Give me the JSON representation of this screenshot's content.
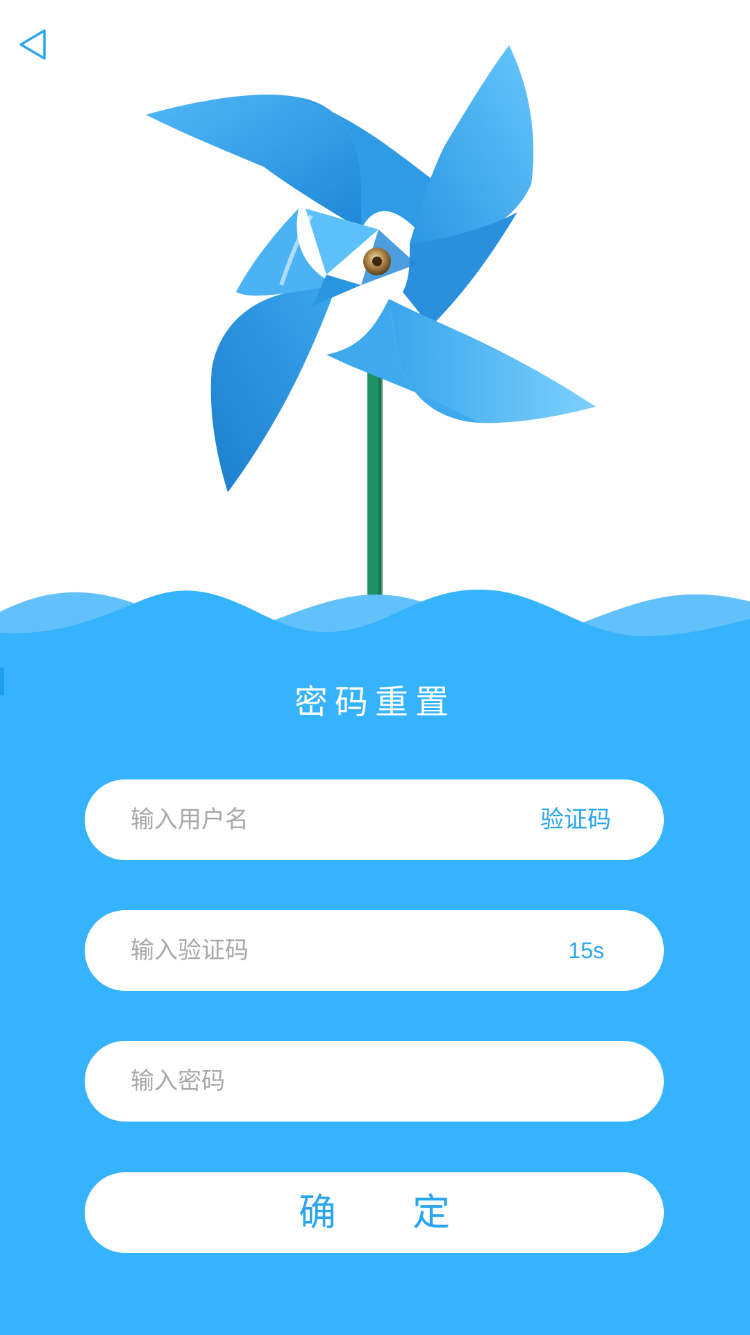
{
  "nav": {
    "back_icon": "back-triangle-icon"
  },
  "illustration": {
    "subject": "pinwheel",
    "colors": {
      "blade_light": "#5ec3fb",
      "blade_mid": "#3aa5ec",
      "blade_dark": "#1f86d6",
      "stick": "#1f8f66",
      "pin": "#b0884a"
    }
  },
  "page": {
    "title": "密码重置"
  },
  "form": {
    "username": {
      "placeholder": "输入用户名",
      "action_label": "验证码"
    },
    "code": {
      "placeholder": "输入验证码",
      "countdown": "15s"
    },
    "password": {
      "placeholder": "输入密码"
    },
    "confirm": {
      "char1": "确",
      "char2": "定"
    }
  },
  "colors": {
    "background": "#ffffff",
    "form_background": "#36b3fd",
    "wave_light": "#62c1fb",
    "accent": "#2aa5f0",
    "placeholder": "#a8a8a8"
  }
}
